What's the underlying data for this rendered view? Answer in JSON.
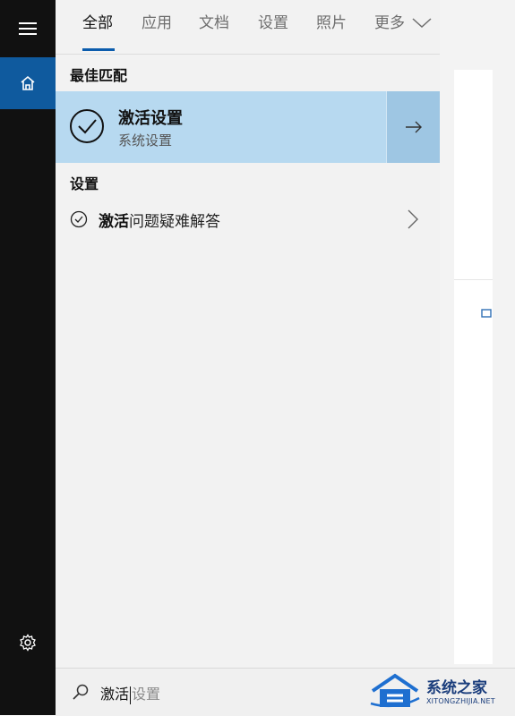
{
  "tabs": {
    "all": "全部",
    "apps": "应用",
    "docs": "文档",
    "settings": "设置",
    "photos": "照片",
    "more": "更多"
  },
  "best_match": {
    "heading": "最佳匹配",
    "title": "激活设置",
    "subtitle": "系统设置"
  },
  "settings_section": {
    "heading": "设置",
    "results": [
      {
        "highlight": "激活",
        "rest": "问题疑难解答"
      }
    ]
  },
  "search": {
    "typed": "激活",
    "ghost": "设置"
  },
  "watermark": {
    "title": "系统之家",
    "site": "XITONGZHIJIA.NET"
  },
  "colors": {
    "sidebar": "#111111",
    "home_active": "#0f5a9e",
    "selected_row": "#b7d9f0",
    "arrow_cell": "#9ec6e3",
    "tab_underline": "#0b5cad"
  }
}
